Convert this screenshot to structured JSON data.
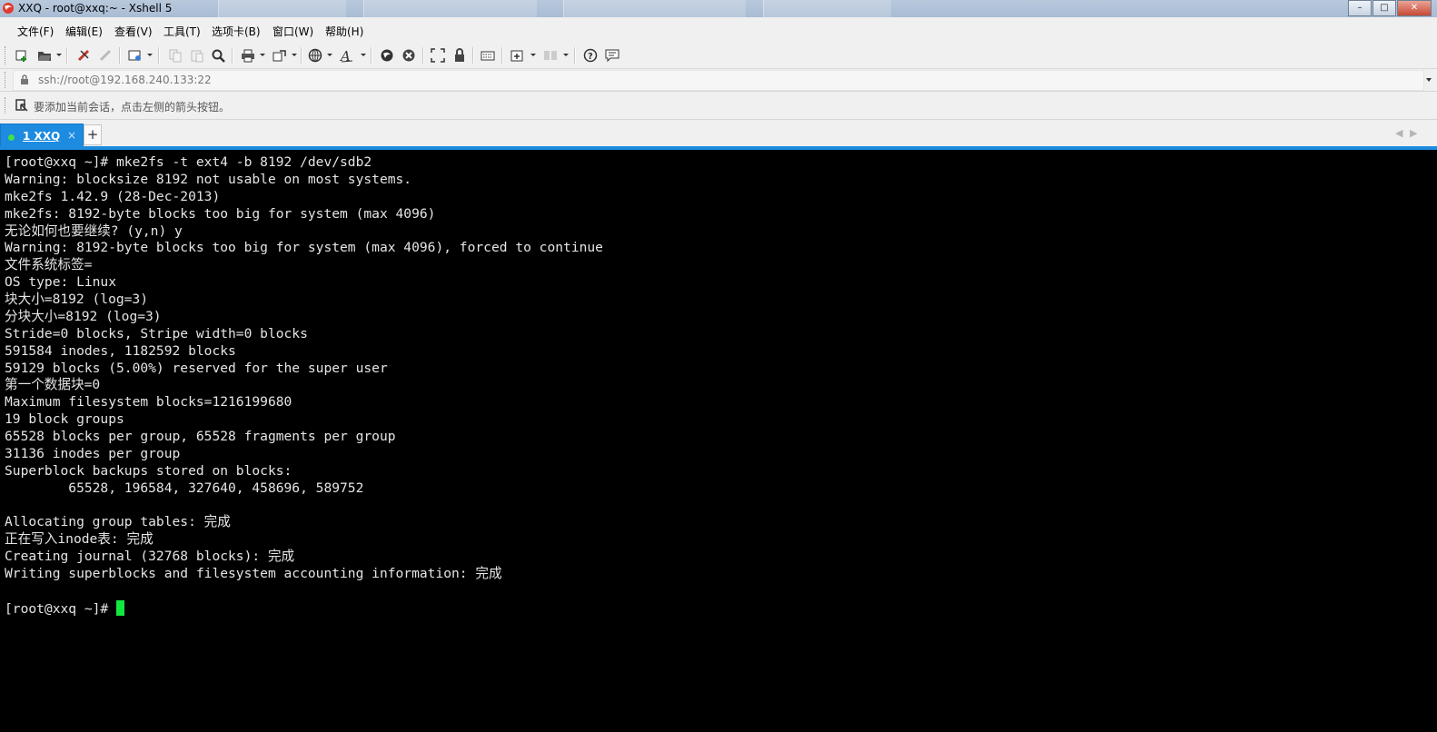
{
  "window": {
    "title": "XXQ - root@xxq:~ - Xshell 5",
    "controls": [
      "minimize-icon",
      "maximize-icon",
      "close-icon"
    ]
  },
  "menu": [
    "文件(F)",
    "编辑(E)",
    "查看(V)",
    "工具(T)",
    "选项卡(B)",
    "窗口(W)",
    "帮助(H)"
  ],
  "toolbar": {
    "icons": [
      "new-session-icon",
      "open-folder-icon",
      "reconnect-icon",
      "disconnect-icon",
      "properties-icon",
      "copy-icon",
      "paste-icon",
      "find-icon",
      "print-icon",
      "transfer-icon",
      "globe-icon",
      "font-icon",
      "xftp-icon",
      "xmanager-icon",
      "fullscreen-icon",
      "lock-icon",
      "keyboard-icon",
      "new-tab-icon",
      "layout-icon",
      "help-icon",
      "chat-icon"
    ]
  },
  "address": {
    "url": "ssh://root@192.168.240.133:22"
  },
  "hint": {
    "text": "要添加当前会话，点击左侧的箭头按钮。"
  },
  "tabs": [
    {
      "label": "1 XXQ",
      "active": true,
      "status_color": "#3fe24b"
    }
  ],
  "terminal": {
    "lines": [
      "[root@xxq ~]# mke2fs -t ext4 -b 8192 /dev/sdb2",
      "Warning: blocksize 8192 not usable on most systems.",
      "mke2fs 1.42.9 (28-Dec-2013)",
      "mke2fs: 8192-byte blocks too big for system (max 4096)",
      "无论如何也要继续? (y,n) y",
      "Warning: 8192-byte blocks too big for system (max 4096), forced to continue",
      "文件系统标签=",
      "OS type: Linux",
      "块大小=8192 (log=3)",
      "分块大小=8192 (log=3)",
      "Stride=0 blocks, Stripe width=0 blocks",
      "591584 inodes, 1182592 blocks",
      "59129 blocks (5.00%) reserved for the super user",
      "第一个数据块=0",
      "Maximum filesystem blocks=1216199680",
      "19 block groups",
      "65528 blocks per group, 65528 fragments per group",
      "31136 inodes per group",
      "Superblock backups stored on blocks:",
      "        65528, 196584, 327640, 458696, 589752",
      "",
      "Allocating group tables: 完成",
      "正在写入inode表: 完成",
      "Creating journal (32768 blocks): 完成",
      "Writing superblocks and filesystem accounting information: 完成",
      ""
    ],
    "prompt": "[root@xxq ~]# ",
    "cursor_color": "#11e83f",
    "background": "#000000",
    "foreground": "#e5e5e5"
  },
  "colors": {
    "accent": "#1c8be0",
    "chrome": "#f0f0f0"
  }
}
